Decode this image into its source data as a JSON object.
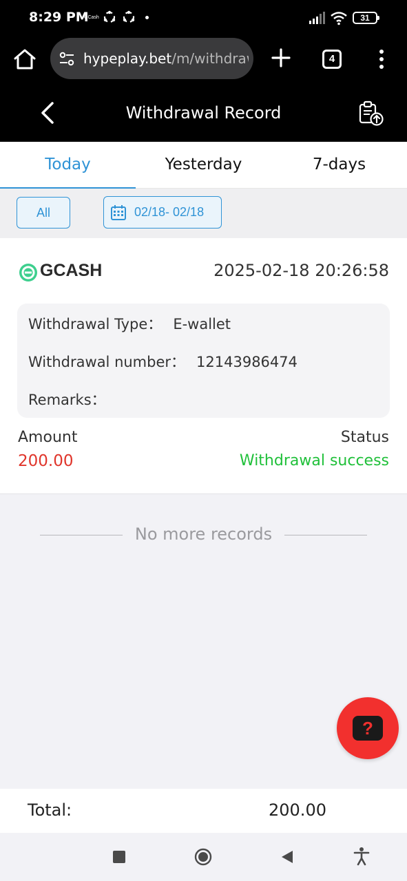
{
  "status_bar": {
    "time": "8:29 PM",
    "notif_app": "GCash",
    "battery": "31"
  },
  "browser": {
    "url_domain": "hypeplay.bet",
    "url_path": "/m/withdrawR",
    "tab_count": "4"
  },
  "header": {
    "title": "Withdrawal Record"
  },
  "tabs": [
    {
      "label": "Today",
      "active": true
    },
    {
      "label": "Yesterday",
      "active": false
    },
    {
      "label": "7-days",
      "active": false
    }
  ],
  "filter": {
    "type_label": "All",
    "date_range": "02/18- 02/18"
  },
  "record": {
    "channel": "GCASH",
    "datetime": "2025-02-18 20:26:58",
    "withdrawal_type_label": "Withdrawal Type：",
    "withdrawal_type_value": "E-wallet",
    "withdrawal_number_label": "Withdrawal number：",
    "withdrawal_number_value": "12143986474",
    "remarks_label": "Remarks：",
    "remarks_value": "",
    "amount_label": "Amount",
    "amount_value": "200.00",
    "status_label": "Status",
    "status_value": "Withdrawal success"
  },
  "list_end_text": "No more records",
  "total": {
    "label": "Total:",
    "value": "200.00"
  },
  "help_button": {
    "symbol": "?"
  },
  "colors": {
    "accent": "#2f93d6",
    "amount": "#e0352b",
    "success": "#20c03a",
    "help_fab": "#f2302e"
  }
}
